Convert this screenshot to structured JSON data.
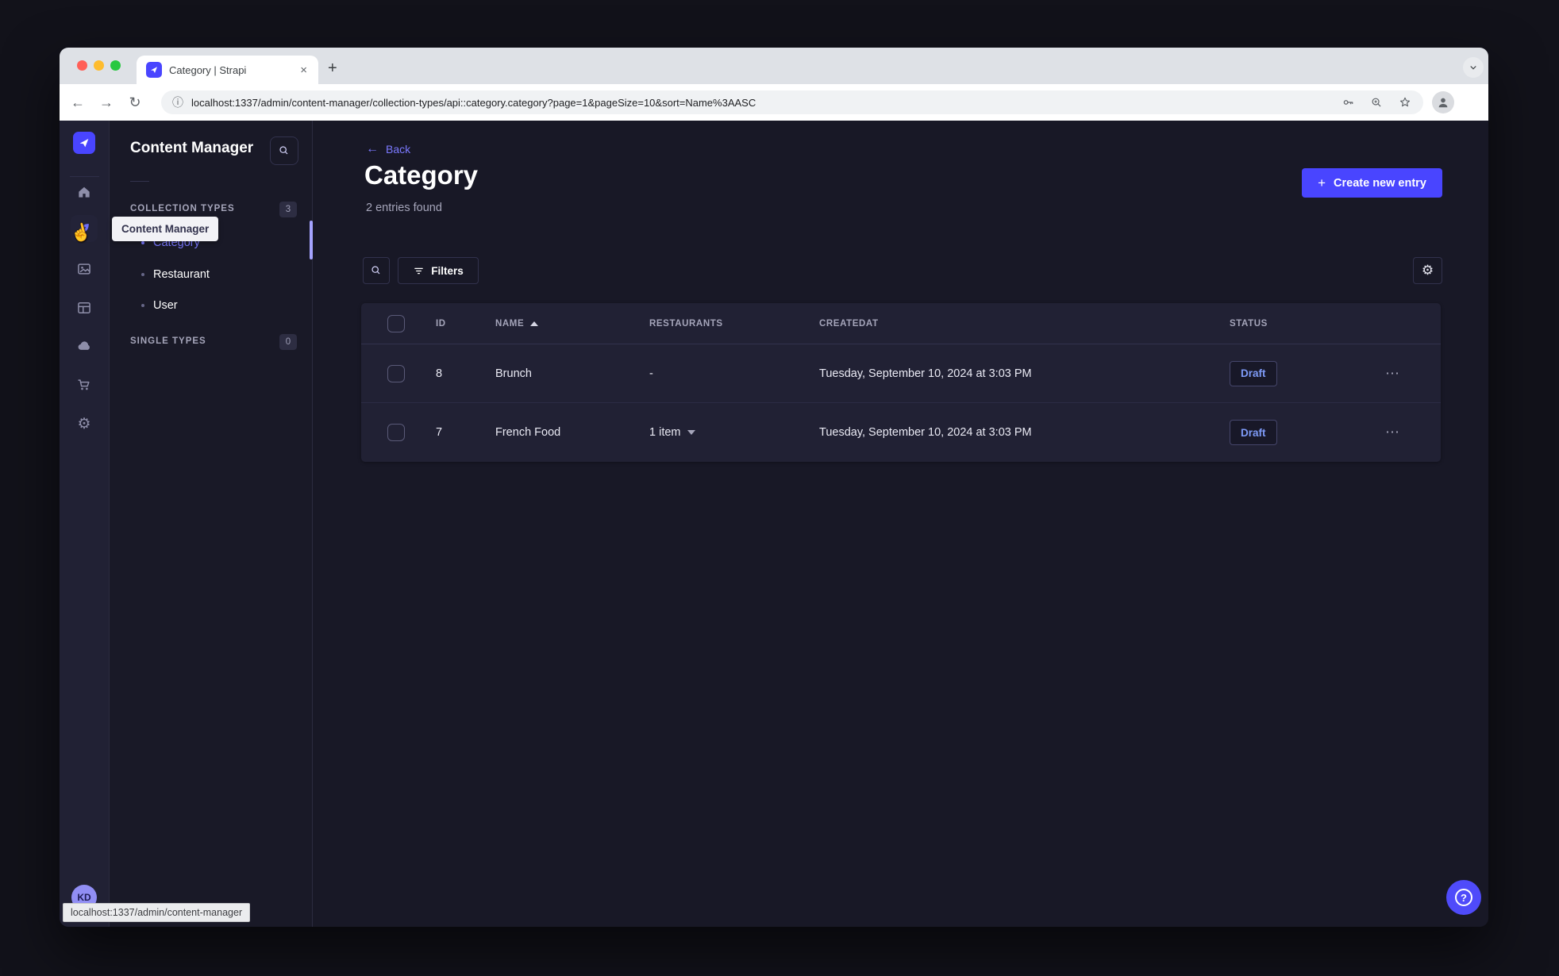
{
  "window": {
    "tab_title": "Category | Strapi",
    "url": "localhost:1337/admin/content-manager/collection-types/api::category.category?page=1&pageSize=10&sort=Name%3AASC",
    "status_link": "localhost:1337/admin/content-manager"
  },
  "rail": {
    "icons": [
      "strapi-logo",
      "home",
      "content-manager",
      "media-library",
      "content-type-builder",
      "cloud",
      "marketplace",
      "settings"
    ],
    "user_initials": "KD"
  },
  "subnav": {
    "title": "Content Manager",
    "collection_types": {
      "label": "COLLECTION TYPES",
      "count": "3",
      "items": [
        {
          "label": "Category",
          "active": true
        },
        {
          "label": "Restaurant",
          "active": false
        },
        {
          "label": "User",
          "active": false
        }
      ]
    },
    "single_types": {
      "label": "SINGLE TYPES",
      "count": "0"
    }
  },
  "tooltip": {
    "label": "Content Manager"
  },
  "page": {
    "back": "Back",
    "title": "Category",
    "subtitle": "2 entries found",
    "create_button": "Create new entry",
    "filters_button": "Filters"
  },
  "table": {
    "columns": [
      "ID",
      "NAME",
      "RESTAURANTS",
      "CREATEDAT",
      "STATUS"
    ],
    "rows": [
      {
        "id": "8",
        "name": "Brunch",
        "restaurants": "-",
        "createdat": "Tuesday, September 10, 2024 at 3:03 PM",
        "status": "Draft"
      },
      {
        "id": "7",
        "name": "French Food",
        "restaurants": "1 item",
        "createdat": "Tuesday, September 10, 2024 at 3:03 PM",
        "status": "Draft"
      }
    ]
  },
  "colors": {
    "accent": "#4945ff",
    "link": "#7b79ff",
    "draft_text": "#7e9bf8",
    "page_bg": "#181826",
    "panel_bg": "#212134",
    "border": "#32324d"
  }
}
